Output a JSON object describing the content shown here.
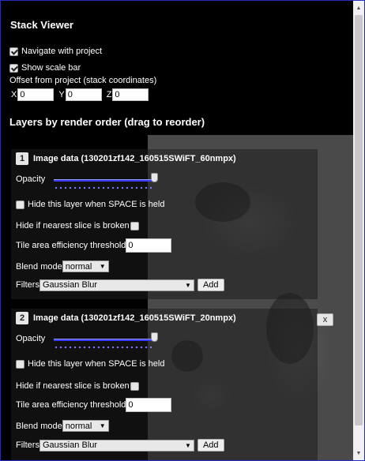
{
  "panel": {
    "title": "Stack Viewer",
    "navigate_label": "Navigate with project",
    "navigate_checked": true,
    "scalebar_label": "Show scale bar",
    "scalebar_checked": true,
    "offset_label": "Offset from project (stack coordinates)",
    "offset": {
      "x_label": "X",
      "x_value": "0",
      "y_label": "Y",
      "y_value": "0",
      "z_label": "Z",
      "z_value": "0"
    },
    "layers_heading": "Layers by render order (drag to reorder)"
  },
  "layers": [
    {
      "number": "1",
      "name": "Image data (130201zf142_160515SWiFT_60nmpx)",
      "opacity_label": "Opacity",
      "opacity": 1.0,
      "hide_space_label": "Hide this layer when SPACE is held",
      "hide_space_checked": false,
      "hide_broken_label": "Hide if nearest slice is broken",
      "hide_broken_checked": false,
      "tile_threshold_label": "Tile area efficiency threshold",
      "tile_threshold_value": "0",
      "blend_label": "Blend mode",
      "blend_value": "normal",
      "filters_label": "Filters",
      "filter_value": "Gaussian Blur",
      "add_label": "Add",
      "has_remove": false
    },
    {
      "number": "2",
      "name": "Image data (130201zf142_160515SWiFT_20nmpx)",
      "opacity_label": "Opacity",
      "opacity": 1.0,
      "hide_space_label": "Hide this layer when SPACE is held",
      "hide_space_checked": false,
      "hide_broken_label": "Hide if nearest slice is broken",
      "hide_broken_checked": false,
      "tile_threshold_label": "Tile area efficiency threshold",
      "tile_threshold_value": "0",
      "blend_label": "Blend mode",
      "blend_value": "normal",
      "filters_label": "Filters",
      "filter_value": "Gaussian Blur",
      "add_label": "Add",
      "remove_label": "x",
      "has_remove": true
    }
  ],
  "icons": {
    "scroll_up": "chevron-up-icon",
    "scroll_down": "chevron-down-icon",
    "select_arrow": "caret-down-icon"
  },
  "colors": {
    "accent_border": "#2a2ac8",
    "slider_track": "#3a3aff"
  }
}
